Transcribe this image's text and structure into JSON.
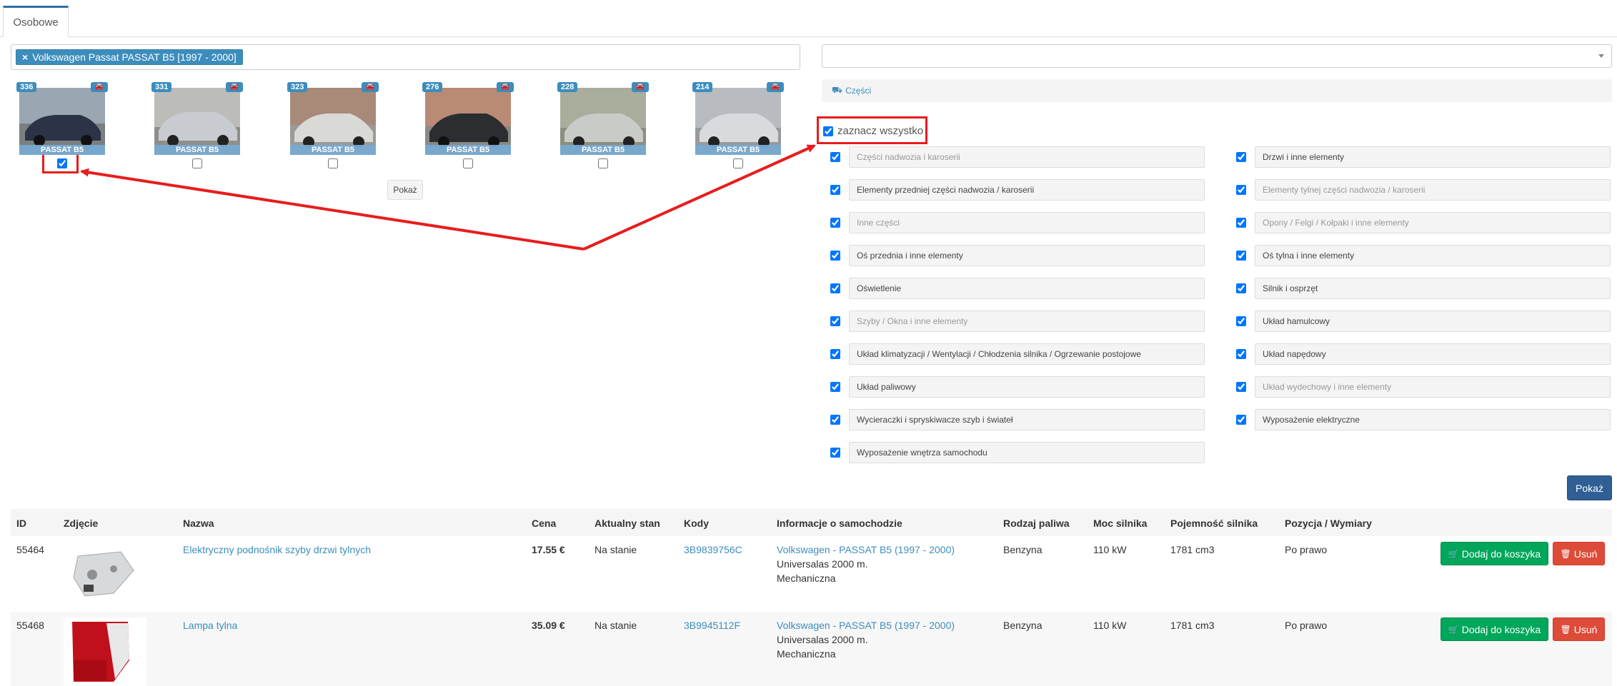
{
  "tabs": [
    {
      "label": "Osobowe"
    }
  ],
  "filter": {
    "tag_label": "Volkswagen Passat PASSAT B5 [1997 - 2000]",
    "remove": "×"
  },
  "cars": [
    {
      "count": "336",
      "label": "PASSAT B5",
      "checked": true,
      "color": "#2b3346"
    },
    {
      "count": "331",
      "label": "PASSAT B5",
      "checked": false,
      "color": "#c8ccd0"
    },
    {
      "count": "323",
      "label": "PASSAT B5",
      "checked": false,
      "color": "#d9d9d6"
    },
    {
      "count": "276",
      "label": "PASSAT B5",
      "checked": false,
      "color": "#2a2e31"
    },
    {
      "count": "228",
      "label": "PASSAT B5",
      "checked": false,
      "color": "#c9cbc8"
    },
    {
      "count": "214",
      "label": "PASSAT B5",
      "checked": false,
      "color": "#d8dbdd"
    }
  ],
  "show_small": "Pokaż",
  "parts_header": "Części",
  "select_all": "zaznacz wszystko",
  "categories": [
    {
      "label": "Części nadwozia i karoserii",
      "dim": true
    },
    {
      "label": "Drzwi i inne elementy",
      "dim": false
    },
    {
      "label": "Elementy przedniej części nadwozia / karoserii",
      "dim": false
    },
    {
      "label": "Elementy tylnej części nadwozia / karoserii",
      "dim": true
    },
    {
      "label": "Inne części",
      "dim": true
    },
    {
      "label": "Opony / Felgi / Kołpaki i inne elementy",
      "dim": true
    },
    {
      "label": "Oś przednia i inne elementy",
      "dim": false
    },
    {
      "label": "Oś tylna i inne elementy",
      "dim": false
    },
    {
      "label": "Oświetlenie",
      "dim": false
    },
    {
      "label": "Silnik i osprzęt",
      "dim": false
    },
    {
      "label": "Szyby / Okna i inne elementy",
      "dim": true
    },
    {
      "label": "Układ hamulcowy",
      "dim": false
    },
    {
      "label": "Układ klimatyzacji / Wentylacji / Chłodzenia silnika / Ogrzewanie postojowe",
      "dim": false
    },
    {
      "label": "Układ napędowy",
      "dim": false
    },
    {
      "label": "Układ paliwowy",
      "dim": false
    },
    {
      "label": "Układ wydechowy i inne elementy",
      "dim": true
    },
    {
      "label": "Wycieraczki i spryskiwacze szyb i świateł",
      "dim": false
    },
    {
      "label": "Wyposażenie elektryczne",
      "dim": false
    },
    {
      "label": "Wyposażenie wnętrza samochodu",
      "dim": false
    }
  ],
  "show_big": "Pokaż",
  "table": {
    "headers": [
      "ID",
      "Zdjęcie",
      "Nazwa",
      "Cena",
      "Aktualny stan",
      "Kody",
      "Informacje o samochodzie",
      "Rodzaj paliwa",
      "Moc silnika",
      "Pojemność silnika",
      "Pozycja / Wymiary"
    ],
    "rows": [
      {
        "id": "55464",
        "name": "Elektryczny podnośnik szyby drzwi tylnych",
        "price": "17.55 €",
        "stock": "Na stanie",
        "code": "3B9839756C",
        "car": "Volkswagen - PASSAT B5 (1997 - 2000)",
        "car_line2": "Universalas 2000 m.",
        "car_line3": "Mechaniczna",
        "fuel": "Benzyna",
        "power": "110 kW",
        "capacity": "1781 cm3",
        "position": "Po prawo"
      },
      {
        "id": "55468",
        "name": "Lampa tylna",
        "price": "35.09 €",
        "stock": "Na stanie",
        "code": "3B9945112F",
        "car": "Volkswagen - PASSAT B5 (1997 - 2000)",
        "car_line2": "Universalas 2000 m.",
        "car_line3": "Mechaniczna",
        "fuel": "Benzyna",
        "power": "110 kW",
        "capacity": "1781 cm3",
        "position": "Po prawo"
      }
    ],
    "add_label": "Dodaj do koszyka",
    "delete_label": "Usuń"
  },
  "accent": "#3c8dbc",
  "annotation_color": "#e81c1c"
}
